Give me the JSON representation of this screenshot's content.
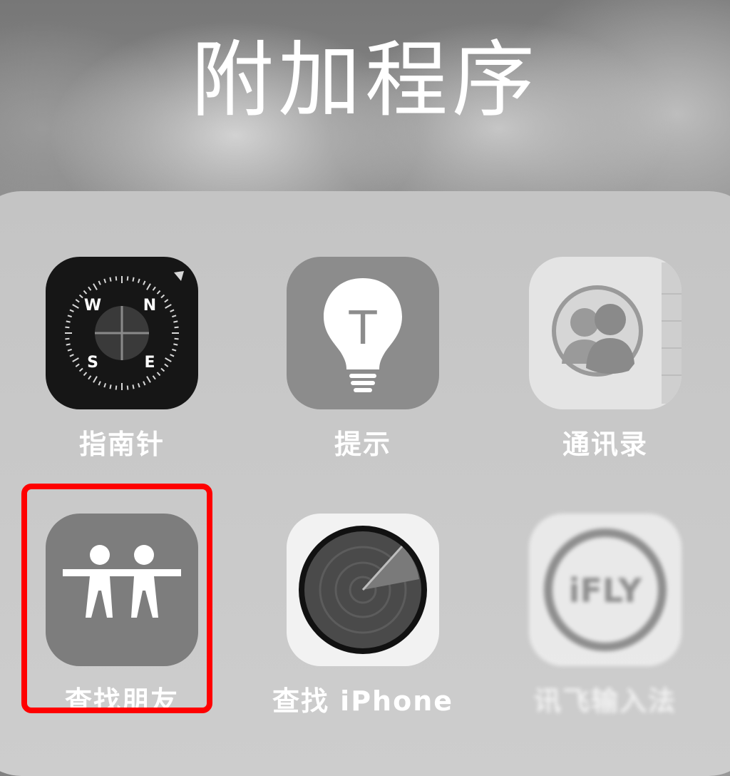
{
  "folder": {
    "title": "附加程序"
  },
  "apps": {
    "compass": {
      "label": "指南针",
      "icon": "compass-icon",
      "directions": [
        "W",
        "N",
        "S",
        "E"
      ]
    },
    "reminders": {
      "label": "提示",
      "icon": "lightbulb-icon",
      "glyph": "T"
    },
    "contacts": {
      "label": "通讯录",
      "icon": "contacts-icon"
    },
    "find_friends": {
      "label": "查找朋友",
      "icon": "friends-icon"
    },
    "find_iphone": {
      "label": "查找 iPhone",
      "icon": "radar-icon"
    },
    "ifly": {
      "label": "讯飞输入法",
      "icon": "ifly-logo-icon",
      "logo_text": "iFLY"
    }
  },
  "highlight": {
    "color": "#ff0000",
    "target": "find_friends"
  }
}
